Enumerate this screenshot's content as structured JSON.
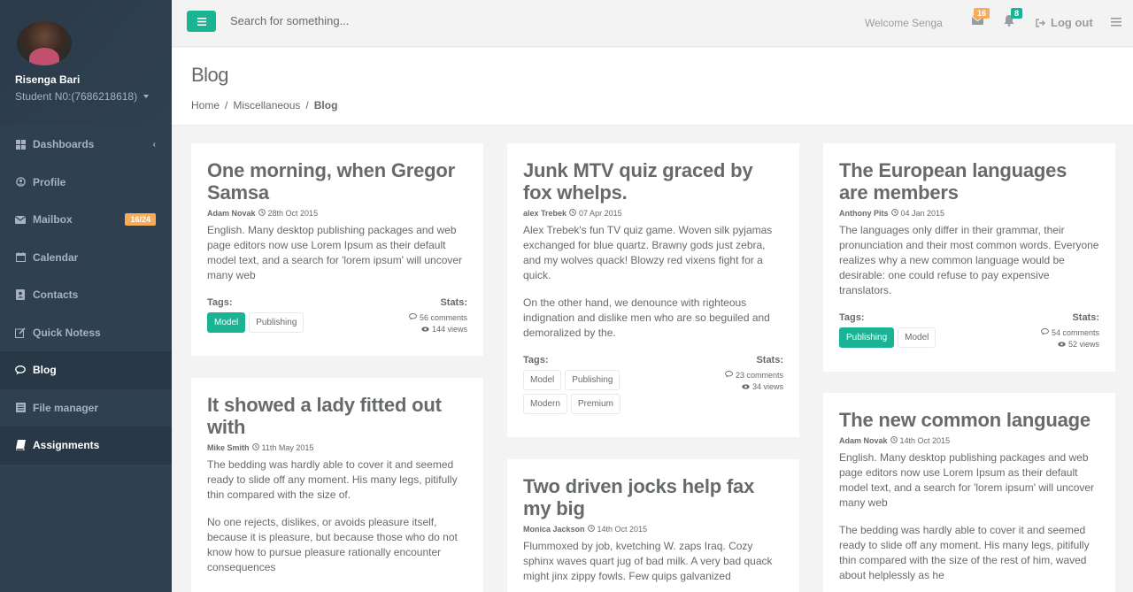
{
  "profile": {
    "name": "Risenga Bari",
    "subtitle": "Student N0:(7686218618)"
  },
  "sidebar": {
    "items": [
      {
        "label": "Dashboards",
        "icon": "th-large-icon"
      },
      {
        "label": "Profile",
        "icon": "user-icon"
      },
      {
        "label": "Mailbox",
        "icon": "envelope-icon",
        "badge": "16/24"
      },
      {
        "label": "Calendar",
        "icon": "calendar-icon"
      },
      {
        "label": "Contacts",
        "icon": "address-card-icon"
      },
      {
        "label": "Quick Notess",
        "icon": "edit-icon"
      },
      {
        "label": "Blog",
        "icon": "comments-icon"
      },
      {
        "label": "File manager",
        "icon": "folder-icon"
      },
      {
        "label": "Assignments",
        "icon": "book-icon"
      }
    ]
  },
  "topbar": {
    "search_placeholder": "Search for something...",
    "welcome": "Welcome Senga",
    "mail_count": "16",
    "bell_count": "8",
    "logout": "Log out"
  },
  "heading": {
    "title": "Blog",
    "breadcrumb": [
      "Home",
      "Miscellaneous",
      "Blog"
    ]
  },
  "labels": {
    "tags": "Tags:",
    "stats": "Stats:"
  },
  "posts": [
    {
      "title": "One morning, when Gregor Samsa",
      "author": "Adam Novak",
      "date": "28th Oct 2015",
      "body": [
        "English. Many desktop publishing packages and web page editors now use Lorem Ipsum as their default model text, and a search for 'lorem ipsum' will uncover many web"
      ],
      "tags": [
        "Model",
        "Publishing"
      ],
      "primary_tag": "Model",
      "comments": "56 comments",
      "views": "144 views"
    },
    {
      "title": "It showed a lady fitted out with",
      "author": "Mike Smith",
      "date": "11th May 2015",
      "body": [
        "The bedding was hardly able to cover it and seemed ready to slide off any moment. His many legs, pitifully thin compared with the size of.",
        "No one rejects, dislikes, or avoids pleasure itself, because it is pleasure, but because those who do not know how to pursue pleasure rationally encounter consequences"
      ]
    },
    {
      "title": "Junk MTV quiz graced by fox whelps.",
      "author": "alex Trebek",
      "date": "07 Apr 2015",
      "body": [
        "Alex Trebek's fun TV quiz game. Woven silk pyjamas exchanged for blue quartz. Brawny gods just zebra, and my wolves quack! Blowzy red vixens fight for a quick.",
        "On the other hand, we denounce with righteous indignation and dislike men who are so beguiled and demoralized by the."
      ],
      "tags": [
        "Model",
        "Publishing",
        "Modern",
        "Premium"
      ],
      "comments": "23 comments",
      "views": "34 views"
    },
    {
      "title": "Two driven jocks help fax my big",
      "author": "Monica Jackson",
      "date": "14th Oct 2015",
      "body": [
        "Flummoxed by job, kvetching W. zaps Iraq. Cozy sphinx waves quart jug of bad milk. A very bad quack might jinx zippy fowls. Few quips galvanized"
      ]
    },
    {
      "title": "The European languages are members",
      "author": "Anthony Pits",
      "date": "04 Jan 2015",
      "body": [
        "The languages only differ in their grammar, their pronunciation and their most common words. Everyone realizes why a new common language would be desirable: one could refuse to pay expensive translators."
      ],
      "tags": [
        "Publishing",
        "Model"
      ],
      "primary_tag": "Publishing",
      "comments": "54 comments",
      "views": "52 views"
    },
    {
      "title": "The new common language",
      "author": "Adam Novak",
      "date": "14th Oct 2015",
      "body": [
        "English. Many desktop publishing packages and web page editors now use Lorem Ipsum as their default model text, and a search for 'lorem ipsum' will uncover many web",
        "The bedding was hardly able to cover it and seemed ready to slide off any moment. His many legs, pitifully thin compared with the size of the rest of him, waved about helplessly as he"
      ]
    }
  ],
  "colors": {
    "sidebar": "#2f4050",
    "accent": "#1ab394",
    "warning": "#f8ac59",
    "text": "#676a6c"
  }
}
